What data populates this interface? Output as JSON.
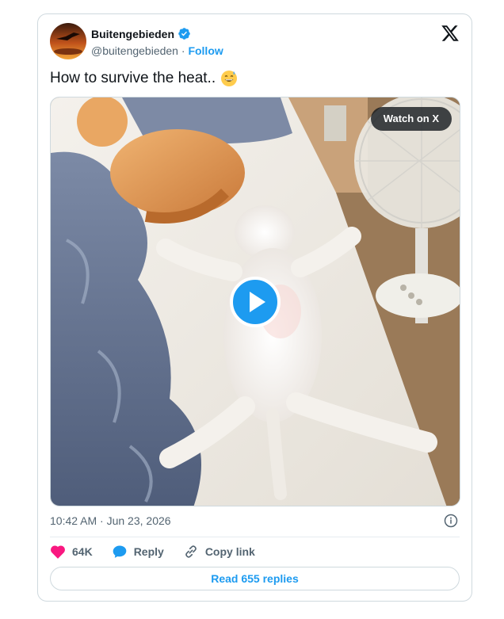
{
  "author": {
    "name": "Buitengebieden",
    "handle": "@buitengebieden",
    "separator": "·",
    "follow_label": "Follow"
  },
  "tweet": {
    "text": "How to survive the heat..",
    "emoji": "grinning-sweat-emoji"
  },
  "media": {
    "watch_label": "Watch on X",
    "type": "video"
  },
  "timestamp": "10:42 AM · Jun 23, 2026",
  "actions": {
    "like_count": "64K",
    "reply_label": "Reply",
    "copy_label": "Copy link"
  },
  "read_replies_label": "Read 655 replies",
  "colors": {
    "accent": "#1d9bf0",
    "like": "#f91880",
    "text": "#0f1419",
    "muted": "#536471",
    "border": "#cfd9de"
  }
}
